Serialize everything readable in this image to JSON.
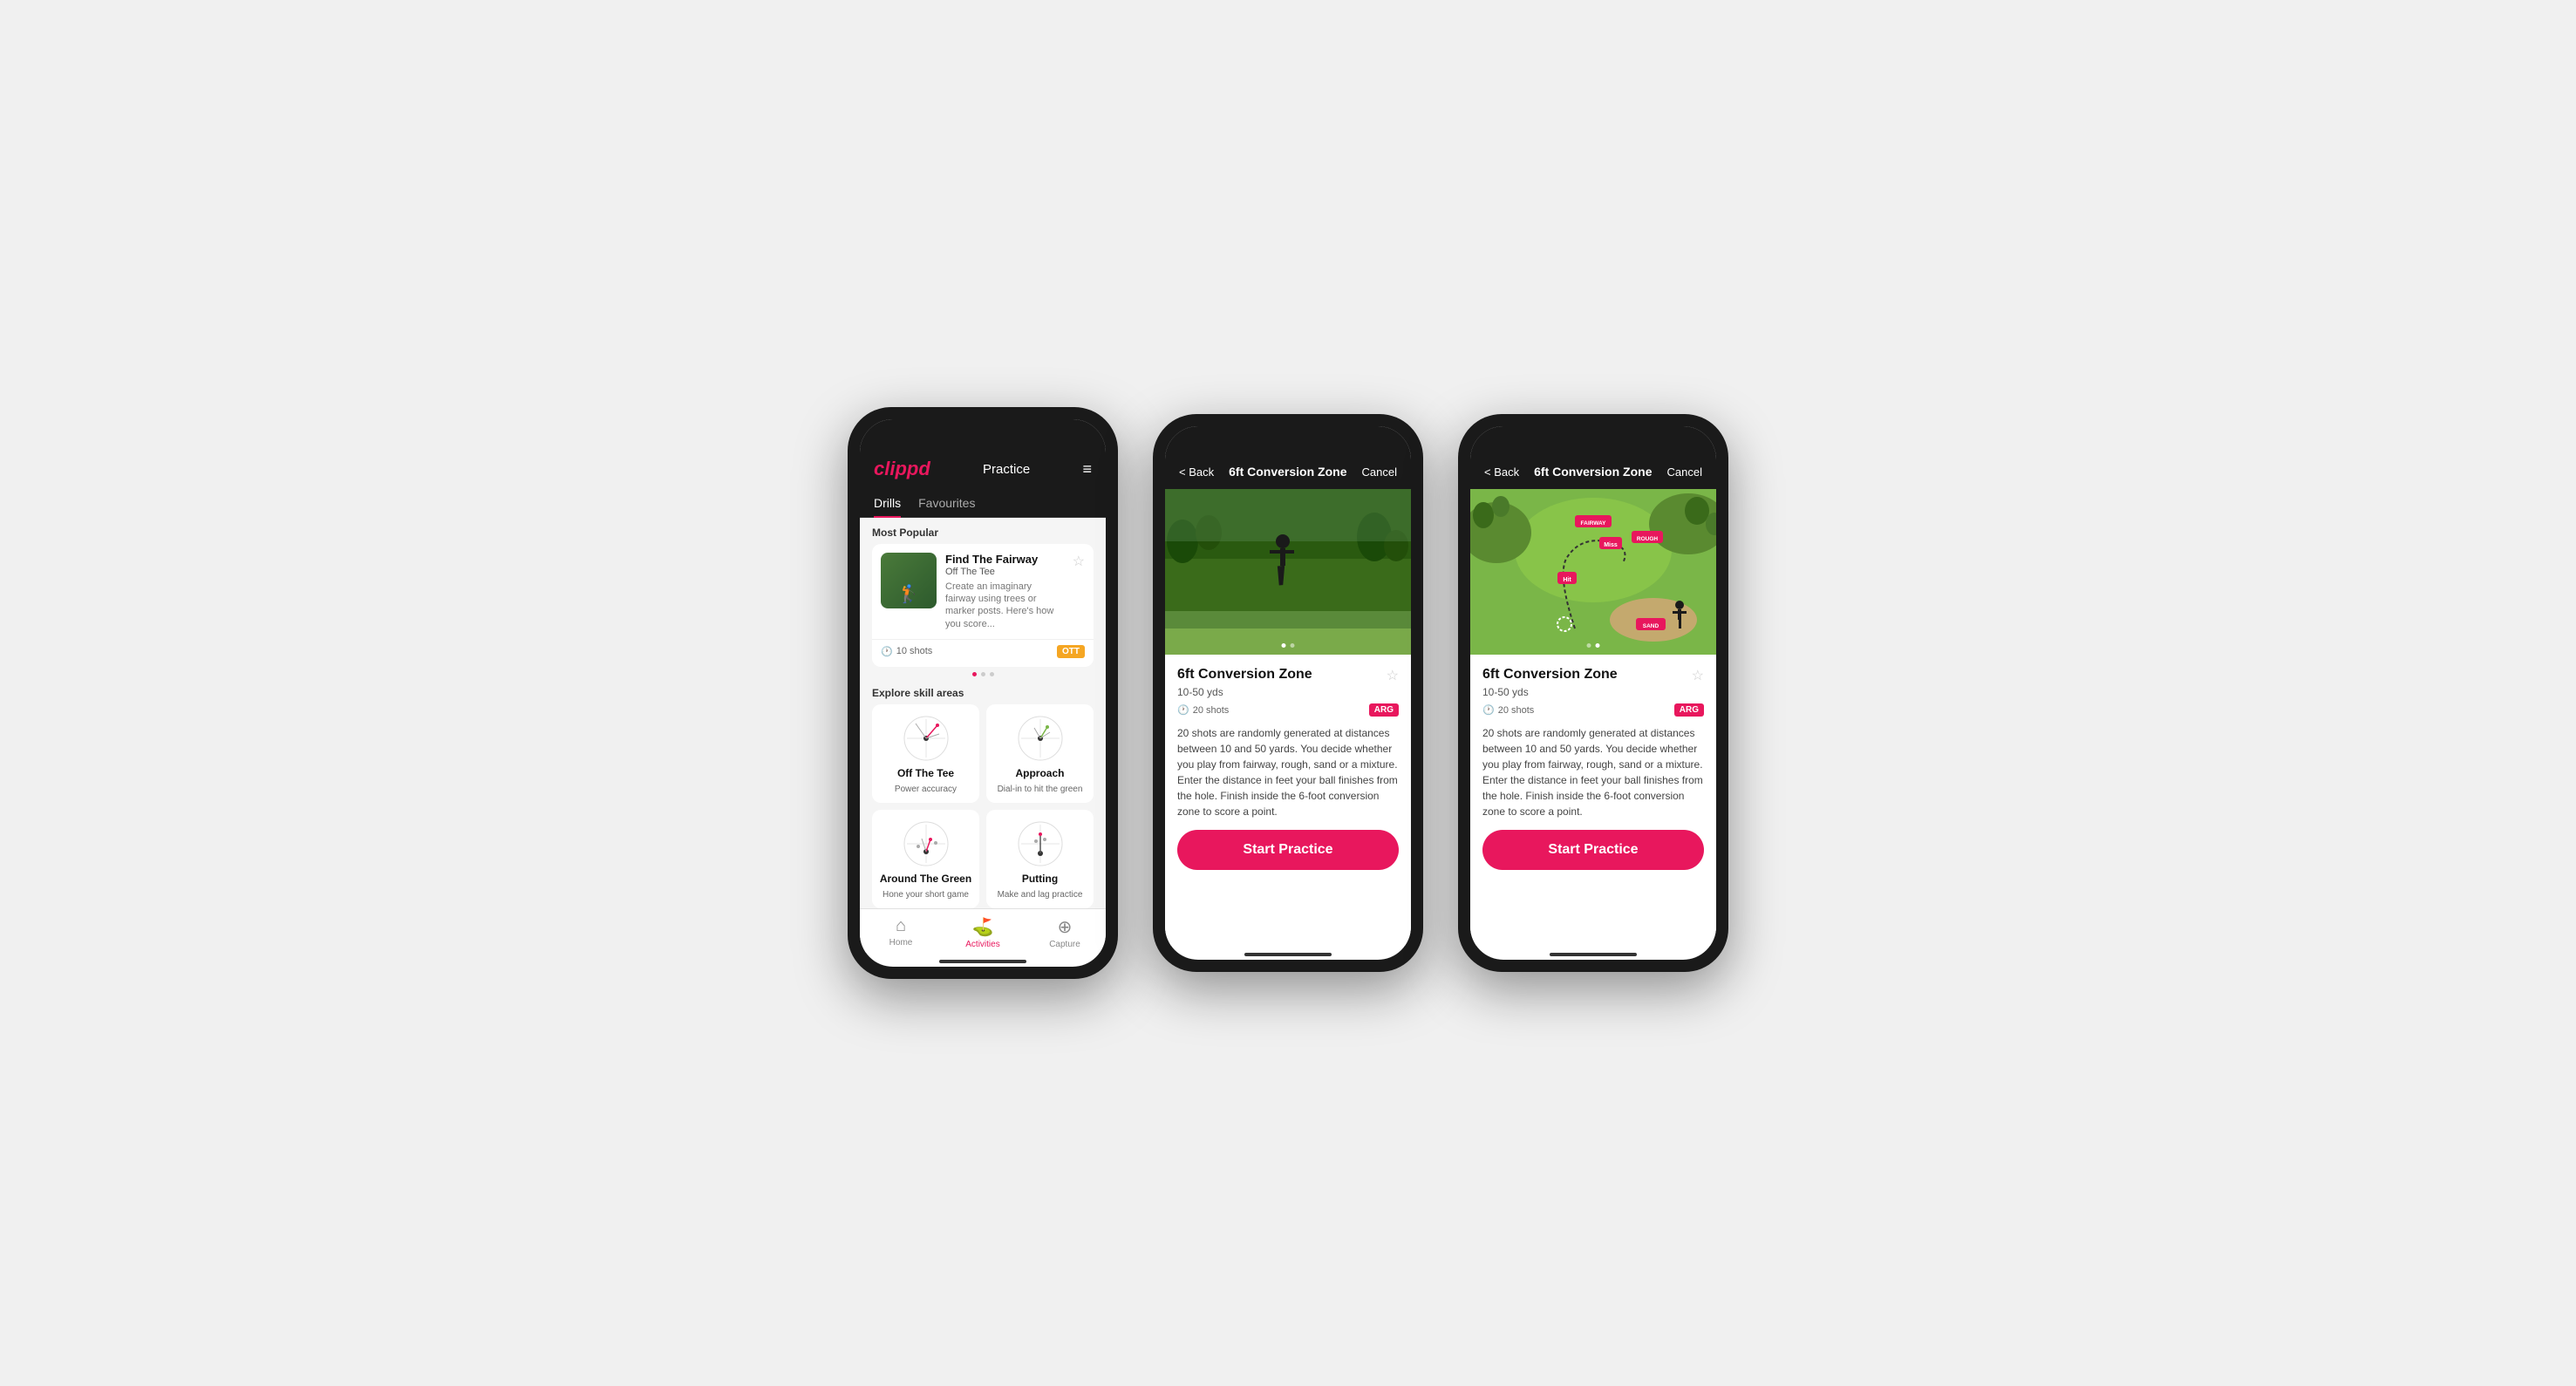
{
  "phone1": {
    "logo": "clippd",
    "header_title": "Practice",
    "menu_icon": "≡",
    "tabs": [
      {
        "label": "Drills",
        "active": true
      },
      {
        "label": "Favourites",
        "active": false
      }
    ],
    "most_popular_label": "Most Popular",
    "featured_card": {
      "title": "Find The Fairway",
      "subtitle": "Off The Tee",
      "description": "Create an imaginary fairway using trees or marker posts. Here's how you score...",
      "shots": "10 shots",
      "tag": "OTT"
    },
    "dots": [
      {
        "active": true
      },
      {
        "active": false
      },
      {
        "active": false
      }
    ],
    "explore_label": "Explore skill areas",
    "skills": [
      {
        "name": "Off The Tee",
        "desc": "Power accuracy"
      },
      {
        "name": "Approach",
        "desc": "Dial-in to hit the green"
      },
      {
        "name": "Around The Green",
        "desc": "Hone your short game"
      },
      {
        "name": "Putting",
        "desc": "Make and lag practice"
      }
    ],
    "nav": [
      {
        "label": "Home",
        "icon": "⌂",
        "active": false
      },
      {
        "label": "Activities",
        "icon": "⛳",
        "active": true
      },
      {
        "label": "Capture",
        "icon": "⊕",
        "active": false
      }
    ]
  },
  "phone2": {
    "back_label": "< Back",
    "header_title": "6ft Conversion Zone",
    "cancel_label": "Cancel",
    "image_dots": [
      {
        "active": true
      },
      {
        "active": false
      }
    ],
    "drill_name": "6ft Conversion Zone",
    "drill_range": "10-50 yds",
    "drill_shots": "20 shots",
    "drill_tag": "ARG",
    "drill_desc": "20 shots are randomly generated at distances between 10 and 50 yards. You decide whether you play from fairway, rough, sand or a mixture. Enter the distance in feet your ball finishes from the hole. Finish inside the 6-foot conversion zone to score a point.",
    "start_btn": "Start Practice"
  },
  "phone3": {
    "back_label": "< Back",
    "header_title": "6ft Conversion Zone",
    "cancel_label": "Cancel",
    "image_dots": [
      {
        "active": false
      },
      {
        "active": true
      }
    ],
    "drill_name": "6ft Conversion Zone",
    "drill_range": "10-50 yds",
    "drill_shots": "20 shots",
    "drill_tag": "ARG",
    "drill_desc": "20 shots are randomly generated at distances between 10 and 50 yards. You decide whether you play from fairway, rough, sand or a mixture. Enter the distance in feet your ball finishes from the hole. Finish inside the 6-foot conversion zone to score a point.",
    "start_btn": "Start Practice",
    "map_labels": [
      "FAIRWAY",
      "ROUGH",
      "Miss",
      "Hit",
      "SAND"
    ]
  }
}
